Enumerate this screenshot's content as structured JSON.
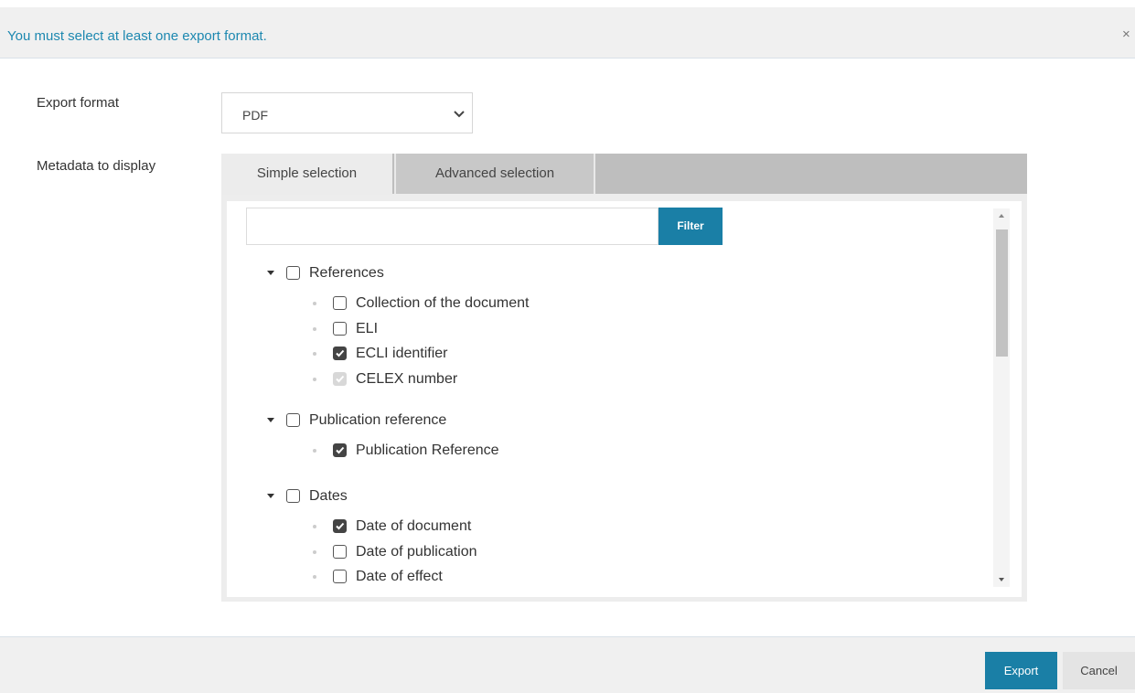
{
  "message": {
    "text": "You must select at least one export format.",
    "close_icon": "close-icon",
    "color": "#1d88b0"
  },
  "form": {
    "export_format_label": "Export format",
    "export_format_value": "PDF",
    "metadata_label": "Metadata to display"
  },
  "tabs": {
    "simple": "Simple selection",
    "advanced": "Advanced selection",
    "active": "simple"
  },
  "filter": {
    "value": "",
    "button_label": "Filter"
  },
  "tree": {
    "groups": [
      {
        "label": "References",
        "checked": false,
        "items": [
          {
            "label": "Collection of the document",
            "state": "unchecked"
          },
          {
            "label": "ELI",
            "state": "unchecked"
          },
          {
            "label": "ECLI identifier",
            "state": "checked"
          },
          {
            "label": "CELEX number",
            "state": "disabled-checked"
          }
        ]
      },
      {
        "label": "Publication reference",
        "checked": false,
        "items": [
          {
            "label": "Publication Reference",
            "state": "checked"
          }
        ]
      },
      {
        "label": "Dates",
        "checked": false,
        "items": [
          {
            "label": "Date of document",
            "state": "checked"
          },
          {
            "label": "Date of publication",
            "state": "unchecked"
          },
          {
            "label": "Date of effect",
            "state": "unchecked"
          }
        ]
      }
    ]
  },
  "footer": {
    "export_label": "Export",
    "cancel_label": "Cancel"
  },
  "colors": {
    "accent": "#1a7fa6",
    "checkbox_checked": "#444444"
  }
}
